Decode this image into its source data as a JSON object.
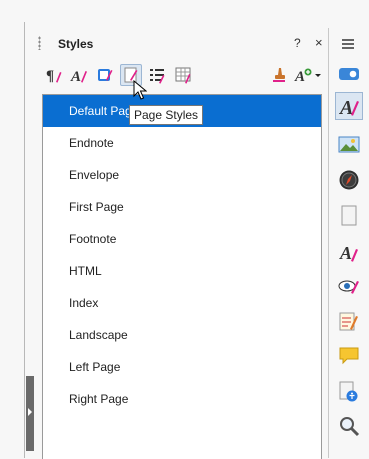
{
  "panel": {
    "title": "Styles",
    "help_label": "?",
    "close_label": "×"
  },
  "toolbar": {
    "icons": [
      "paragraph-styles-icon",
      "character-styles-icon",
      "frame-styles-icon",
      "page-styles-icon",
      "list-styles-icon",
      "table-styles-icon",
      "fill-format-mode-icon",
      "new-style-icon"
    ],
    "active": "page-styles-icon"
  },
  "tooltip": "Page Styles",
  "styles": [
    "Default Page Style",
    "Endnote",
    "Envelope",
    "First Page",
    "Footnote",
    "HTML",
    "Index",
    "Landscape",
    "Left Page",
    "Right Page"
  ],
  "selected_index": 0,
  "sidebar": {
    "icons": [
      "toggle-icon",
      "styles-icon",
      "gallery-icon",
      "navigator-icon",
      "page-icon",
      "style-inspector-icon",
      "manage-changes-icon",
      "design-icon",
      "comments-icon",
      "accessibility-check-icon",
      "find-icon"
    ],
    "active": "styles-icon"
  },
  "colors": {
    "selection": "#0a6ed1",
    "accent_pink": "#e0218a"
  }
}
